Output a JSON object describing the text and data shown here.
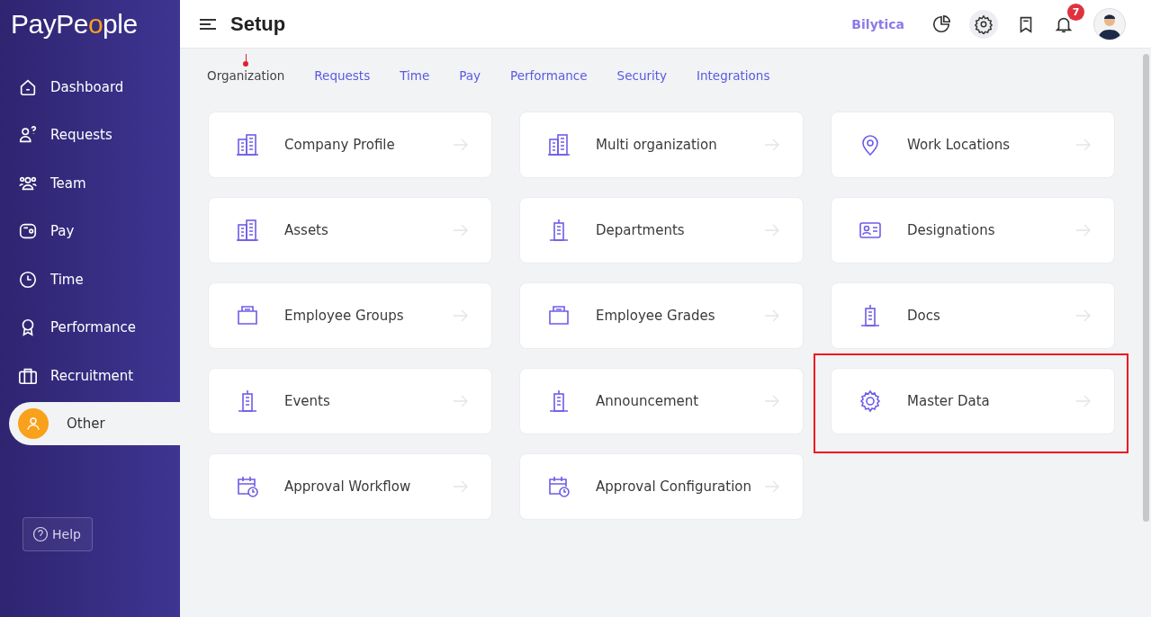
{
  "sidebar": {
    "logo": {
      "before": "PayPe",
      "accent": "o",
      "after": "ple"
    },
    "items": [
      {
        "label": "Dashboard",
        "kind": "home",
        "selected": false
      },
      {
        "label": "Requests",
        "kind": "request",
        "selected": false
      },
      {
        "label": "Team",
        "kind": "team",
        "selected": false
      },
      {
        "label": "Pay",
        "kind": "wallet",
        "selected": false
      },
      {
        "label": "Time",
        "kind": "clock",
        "selected": false
      },
      {
        "label": "Performance",
        "kind": "award",
        "selected": false
      },
      {
        "label": "Recruitment",
        "kind": "briefcase",
        "selected": false
      },
      {
        "label": "Other",
        "kind": "user",
        "selected": true
      }
    ],
    "help": "Help"
  },
  "header": {
    "title": "Setup",
    "company": "Bilytica",
    "notification_count": "7"
  },
  "tabs": [
    {
      "label": "Organization",
      "selected": true
    },
    {
      "label": "Requests",
      "selected": false
    },
    {
      "label": "Time",
      "selected": false
    },
    {
      "label": "Pay",
      "selected": false
    },
    {
      "label": "Performance",
      "selected": false
    },
    {
      "label": "Security",
      "selected": false
    },
    {
      "label": "Integrations",
      "selected": false
    }
  ],
  "cards": [
    {
      "label": "Company Profile",
      "kind": "buildings",
      "highlighted": false
    },
    {
      "label": "Multi organization",
      "kind": "buildings",
      "highlighted": false
    },
    {
      "label": "Work Locations",
      "kind": "pin",
      "highlighted": false
    },
    {
      "label": "Assets",
      "kind": "buildings",
      "highlighted": false
    },
    {
      "label": "Departments",
      "kind": "tower",
      "highlighted": false
    },
    {
      "label": "Designations",
      "kind": "idcard",
      "highlighted": false
    },
    {
      "label": "Employee Groups",
      "kind": "folder",
      "highlighted": false
    },
    {
      "label": "Employee Grades",
      "kind": "folder",
      "highlighted": false
    },
    {
      "label": "Docs",
      "kind": "tower",
      "highlighted": false
    },
    {
      "label": "Events",
      "kind": "tower",
      "highlighted": false
    },
    {
      "label": "Announcement",
      "kind": "tower",
      "highlighted": false
    },
    {
      "label": "Master Data",
      "kind": "gear",
      "highlighted": true
    },
    {
      "label": "Approval Workflow",
      "kind": "calendar",
      "highlighted": false
    },
    {
      "label": "Approval Configuration",
      "kind": "calendar",
      "highlighted": false
    }
  ]
}
